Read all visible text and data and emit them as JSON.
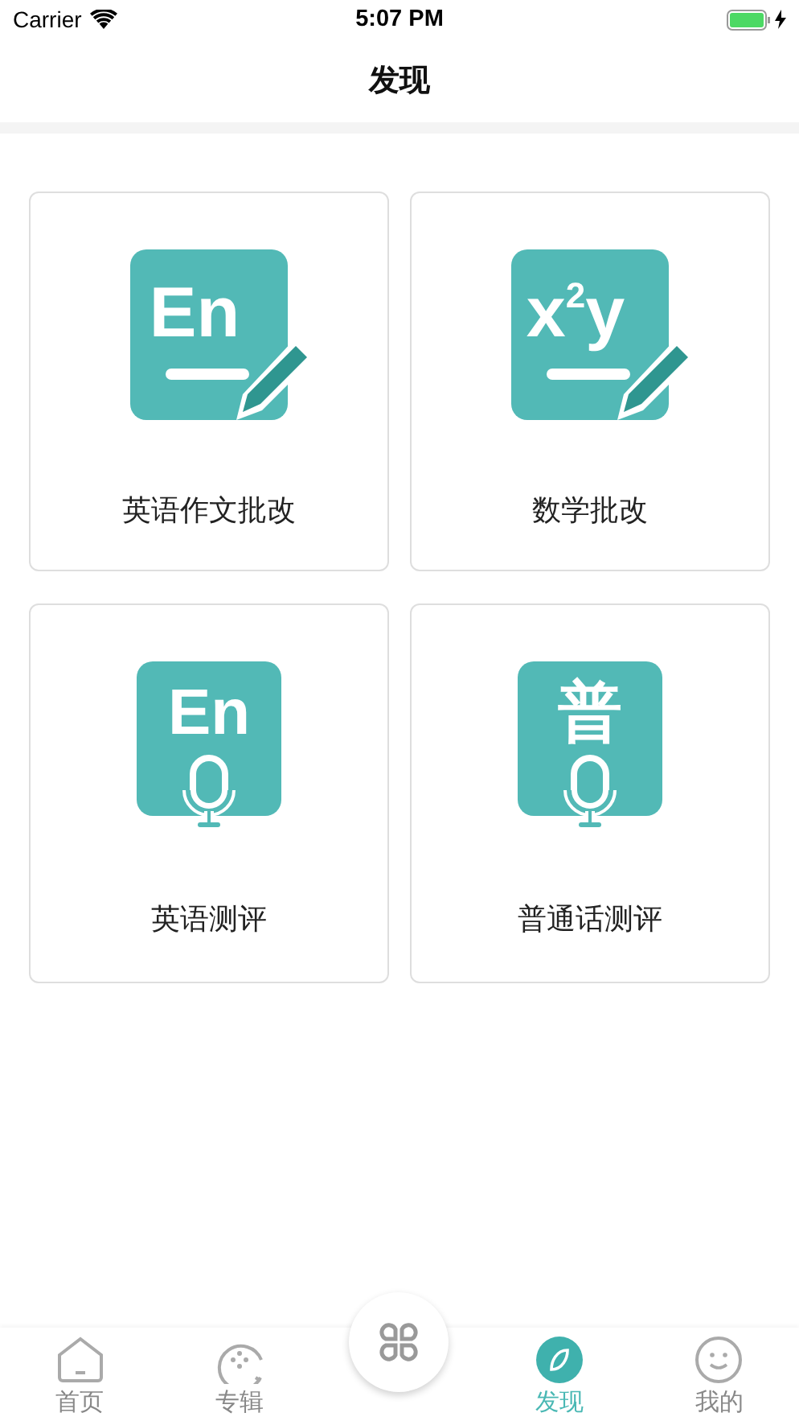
{
  "status_bar": {
    "carrier": "Carrier",
    "time": "5:07 PM",
    "charging": true
  },
  "nav": {
    "title": "发现"
  },
  "cards": [
    {
      "label": "英语作文批改",
      "glyph": "En",
      "kind": "pencil"
    },
    {
      "label": "数学批改",
      "glyph": "x$^{2}$y",
      "kind": "pencil"
    },
    {
      "label": "英语测评",
      "glyph": "En",
      "kind": "mic"
    },
    {
      "label": "普通话测评",
      "glyph": "普",
      "kind": "mic"
    }
  ],
  "tabs": [
    {
      "label": "首页",
      "kind": "home",
      "selected": false
    },
    {
      "label": "专辑",
      "kind": "album",
      "selected": false
    },
    {
      "label": "发现",
      "kind": "discover",
      "selected": true
    },
    {
      "label": "我的",
      "kind": "me",
      "selected": false
    }
  ]
}
